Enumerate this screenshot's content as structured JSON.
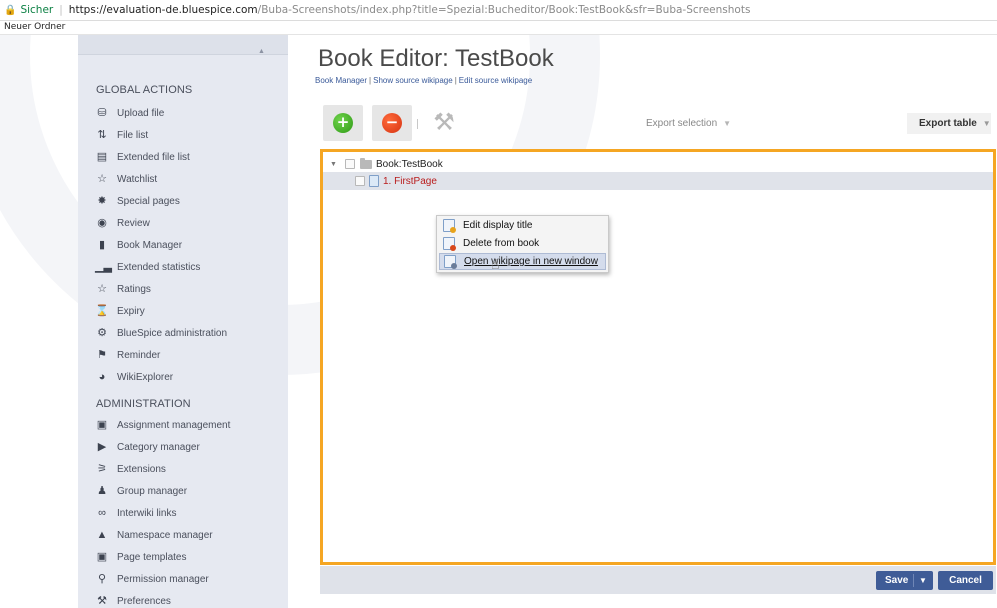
{
  "browser": {
    "secure_label": "Sicher",
    "url_main": "https://evaluation-de.bluespice.com",
    "url_rest": "/Buba-Screenshots/index.php?title=Spezial:Bucheditor/Book:TestBook&sfr=Buba-Screenshots",
    "bookmark_folder": "Neuer Ordner"
  },
  "sidebar": {
    "global_heading": "GLOBAL ACTIONS",
    "global_items": [
      {
        "label": "Upload file",
        "icon": "upload-icon"
      },
      {
        "label": "File list",
        "icon": "sort-icon"
      },
      {
        "label": "Extended file list",
        "icon": "list-icon"
      },
      {
        "label": "Watchlist",
        "icon": "star-icon"
      },
      {
        "label": "Special pages",
        "icon": "special-icon"
      },
      {
        "label": "Review",
        "icon": "eye-icon"
      },
      {
        "label": "Book Manager",
        "icon": "book-icon"
      },
      {
        "label": "Extended statistics",
        "icon": "chart-icon"
      },
      {
        "label": "Ratings",
        "icon": "star-icon"
      },
      {
        "label": "Expiry",
        "icon": "hourglass-icon"
      },
      {
        "label": "BlueSpice administration",
        "icon": "gear-icon"
      },
      {
        "label": "Reminder",
        "icon": "flag-icon"
      },
      {
        "label": "WikiExplorer",
        "icon": "globe-icon"
      }
    ],
    "admin_heading": "ADMINISTRATION",
    "admin_items": [
      {
        "label": "Assignment management",
        "icon": "assignment-icon"
      },
      {
        "label": "Category manager",
        "icon": "tag-icon"
      },
      {
        "label": "Extensions",
        "icon": "puzzle-icon"
      },
      {
        "label": "Group manager",
        "icon": "group-icon"
      },
      {
        "label": "Interwiki links",
        "icon": "link-icon"
      },
      {
        "label": "Namespace manager",
        "icon": "namespace-icon"
      },
      {
        "label": "Page templates",
        "icon": "template-icon"
      },
      {
        "label": "Permission manager",
        "icon": "key-icon"
      },
      {
        "label": "Preferences",
        "icon": "wrench-icon"
      }
    ]
  },
  "main": {
    "title": "Book Editor: TestBook",
    "subnav": [
      "Book Manager",
      "Show source wikipage",
      "Edit source wikipage"
    ],
    "subnav_divider": "|",
    "toolbar": {
      "add_symbol": "+",
      "remove_symbol": "−",
      "tools_symbol": "⚒",
      "export_selection": "Export selection",
      "export_table": "Export table",
      "caret": "▼"
    },
    "tree": {
      "book_label": "Book:TestBook",
      "page_label": "1. FirstPage",
      "expander": "▼"
    },
    "context_menu": {
      "edit_title": "Edit display title",
      "delete": "Delete from book",
      "open_new_window": "Open wikipage in new window"
    },
    "footer": {
      "save": "Save",
      "cancel": "Cancel",
      "caret": "▼"
    }
  },
  "colors": {
    "accent_border": "#f5a623",
    "primary_button": "#3f5c97",
    "sidebar_bg": "#e6e9f1",
    "link": "#3a5a99",
    "page_link_red": "#b91c1c"
  }
}
